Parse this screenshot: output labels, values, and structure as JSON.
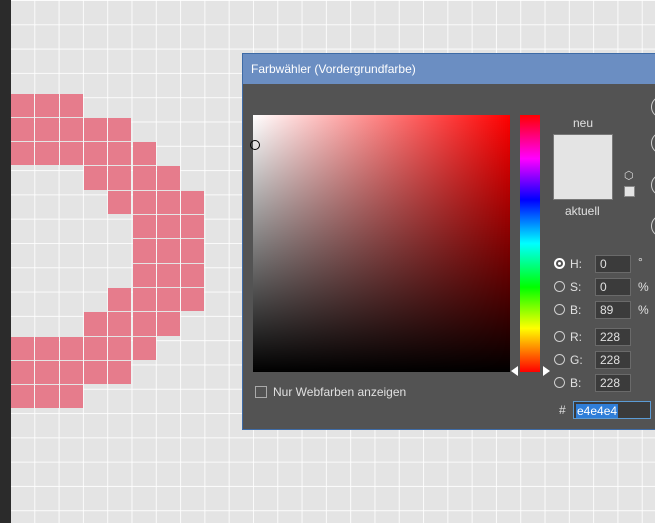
{
  "canvas": {
    "pixel_color": "#e67c8c",
    "background_color": "#e4e4e4"
  },
  "dialog": {
    "title": "Farbwähler (Vordergrundfarbe)",
    "labels": {
      "new": "neu",
      "current": "aktuell"
    },
    "current_color": "#e4e4e4",
    "new_color": "#e4e4e4",
    "hsb": {
      "h": {
        "label": "H:",
        "value": "0",
        "unit": "°"
      },
      "s": {
        "label": "S:",
        "value": "0",
        "unit": "%"
      },
      "b": {
        "label": "B:",
        "value": "89",
        "unit": "%"
      }
    },
    "rgb": {
      "r": {
        "label": "R:",
        "value": "228"
      },
      "g": {
        "label": "G:",
        "value": "228"
      },
      "b": {
        "label": "B:",
        "value": "228"
      }
    },
    "hex": {
      "label": "#",
      "value": "e4e4e4"
    },
    "web_colors_only": {
      "label": "Nur Webfarben anzeigen",
      "checked": false
    },
    "selected_mode": "H",
    "icons": [
      "cube-icon"
    ]
  }
}
